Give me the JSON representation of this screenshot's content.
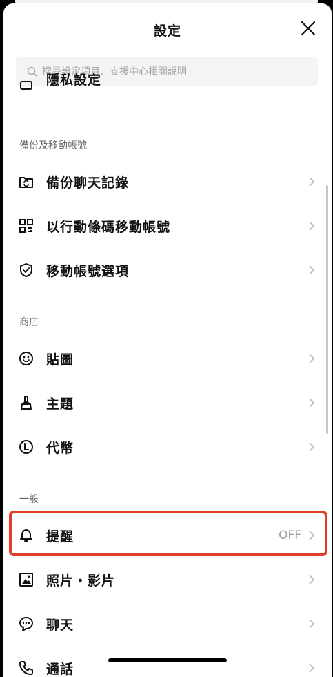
{
  "header": {
    "title": "設定"
  },
  "search": {
    "placeholder": "搜尋設定項目、支援中心相關說明"
  },
  "partial_item": {
    "label": "隱私設定"
  },
  "sections": {
    "backup": "備份及移動帳號",
    "store": "商店",
    "general": "一般"
  },
  "items": {
    "backup_chats": "備份聊天記錄",
    "transfer_qr": "以行動條碼移動帳號",
    "transfer_options": "移動帳號選項",
    "stickers": "貼圖",
    "themes": "主題",
    "coins": "代幣",
    "notifications": "提醒",
    "notifications_value": "OFF",
    "photos_videos": "照片・影片",
    "chats": "聊天",
    "calls": "通話"
  },
  "colors": {
    "highlight": "#e23d28"
  }
}
